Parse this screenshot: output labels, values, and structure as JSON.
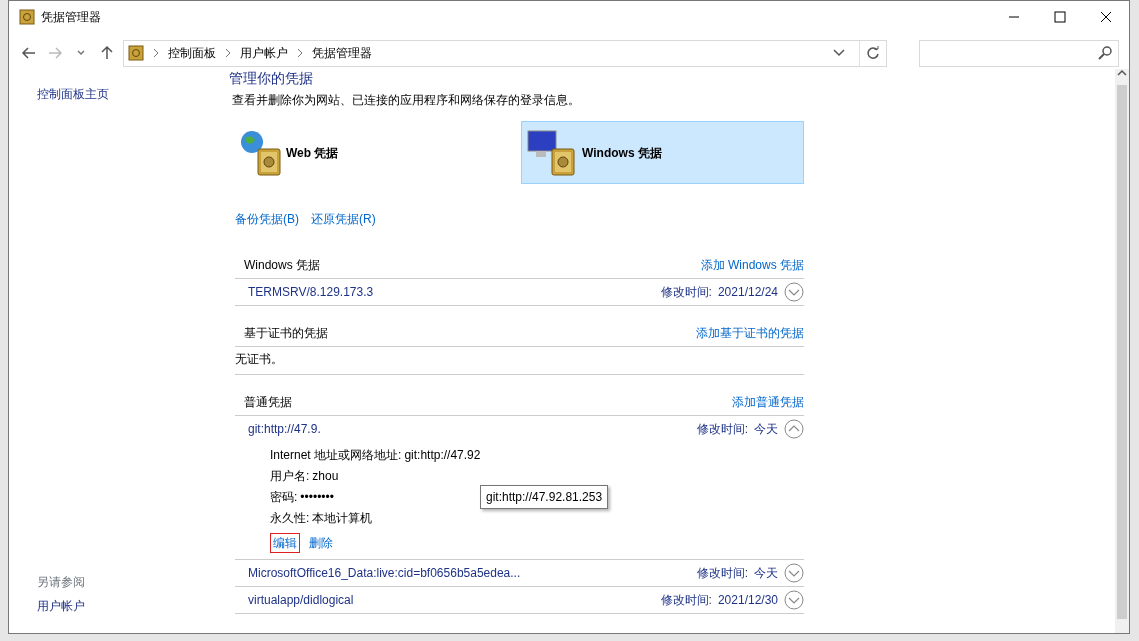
{
  "window": {
    "title": "凭据管理器"
  },
  "breadcrumb": [
    "控制面板",
    "用户帐户",
    "凭据管理器"
  ],
  "sidebar": {
    "home": "控制面板主页",
    "see_also": "另请参阅",
    "links": [
      "用户帐户"
    ]
  },
  "main": {
    "heading": "管理你的凭据",
    "description": "查看并删除你为网站、已连接的应用程序和网络保存的登录信息。",
    "vaults": [
      {
        "kind": "web",
        "label": "Web 凭据",
        "selected": false
      },
      {
        "kind": "windows",
        "label": "Windows 凭据",
        "selected": true
      }
    ],
    "actions": [
      "备份凭据(B)",
      "还原凭据(R)"
    ],
    "sections": [
      {
        "title": "Windows 凭据",
        "add_link": "添加 Windows 凭据",
        "entries": [
          {
            "name": "TERMSRV/8.129.173.3",
            "modified_label": "修改时间:",
            "modified_value": "2021/12/24",
            "expanded": false
          }
        ]
      },
      {
        "title": "基于证书的凭据",
        "add_link": "添加基于证书的凭据",
        "empty_text": "无证书。"
      },
      {
        "title": "普通凭据",
        "add_link": "添加普通凭据",
        "entries": [
          {
            "name": "git:http://47.9.",
            "modified_label": "修改时间:",
            "modified_value": "今天",
            "expanded": true,
            "details": [
              {
                "label": "Internet 地址或网络地址:",
                "value": "git:http://47.92"
              },
              {
                "label": "用户名:",
                "value": "zhou"
              },
              {
                "label": "密码:",
                "value": "••••••••"
              },
              {
                "label": "永久性:",
                "value": "本地计算机"
              }
            ],
            "actions": [
              {
                "label": "编辑",
                "highlighted": true
              },
              {
                "label": "删除",
                "highlighted": false
              }
            ]
          },
          {
            "name": "MicrosoftOffice16_Data:live:cid=bf0656b5a5edea...",
            "modified_label": "修改时间:",
            "modified_value": "今天",
            "expanded": false
          },
          {
            "name": "virtualapp/didlogical",
            "modified_label": "修改时间:",
            "modified_value": "2021/12/30",
            "expanded": false
          }
        ]
      }
    ]
  },
  "tooltip": "git:http://47.92.81.253"
}
